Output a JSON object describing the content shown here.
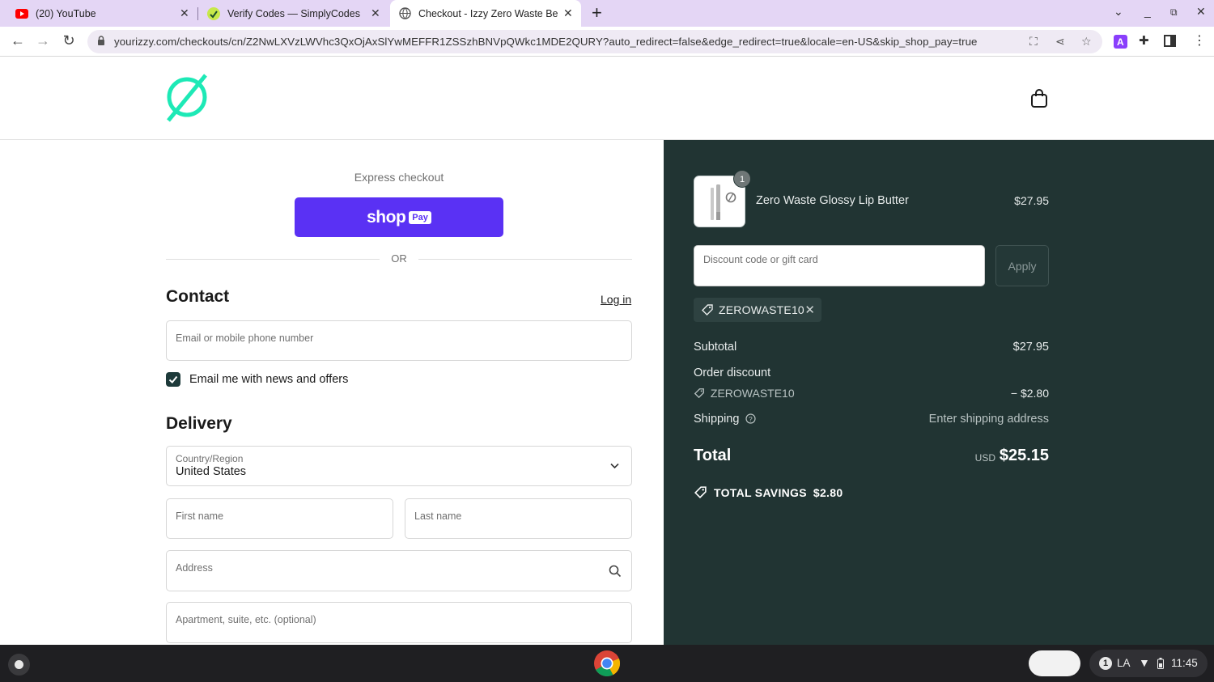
{
  "browser": {
    "tabs": [
      {
        "title": "(20) YouTube",
        "icon": "youtube-icon"
      },
      {
        "title": "Verify Codes — SimplyCodes",
        "icon": "simplycodes-icon"
      },
      {
        "title": "Checkout - Izzy Zero Waste Beau",
        "icon": "globe-icon",
        "active": true
      }
    ],
    "url": "yourizzy.com/checkouts/cn/Z2NwLXVzLWVhc3QxOjAxSlYwMEFFR1ZSSzhBNVpQWkc1MDE2QURY?auto_redirect=false&edge_redirect=true&locale=en-US&skip_shop_pay=true"
  },
  "checkout": {
    "express_label": "Express checkout",
    "shop_label": "shop",
    "pay_label": "Pay",
    "or_label": "OR",
    "contact_title": "Contact",
    "login_label": "Log in",
    "email_placeholder": "Email or mobile phone number",
    "news_label": "Email me with news and offers",
    "news_checked": true,
    "delivery_title": "Delivery",
    "country_label": "Country/Region",
    "country_value": "United States",
    "first_name_placeholder": "First name",
    "last_name_placeholder": "Last name",
    "address_placeholder": "Address",
    "apartment_placeholder": "Apartment, suite, etc. (optional)"
  },
  "summary": {
    "product": {
      "name": "Zero Waste Glossy Lip Butter",
      "price": "$27.95",
      "quantity": "1"
    },
    "discount_placeholder": "Discount code or gift card",
    "apply_label": "Apply",
    "applied_code": "ZEROWASTE10",
    "subtotal_label": "Subtotal",
    "subtotal_value": "$27.95",
    "order_discount_label": "Order discount",
    "discount_code": "ZEROWASTE10",
    "discount_value": "− $2.80",
    "shipping_label": "Shipping",
    "shipping_value": "Enter shipping address",
    "total_label": "Total",
    "total_currency": "USD",
    "total_value": "$25.15",
    "savings_label": "TOTAL SAVINGS",
    "savings_value": "$2.80"
  },
  "shelf": {
    "notification_count": "1",
    "input_method": "LA",
    "time": "11:45"
  },
  "colors": {
    "shop_pay": "#5a31f4",
    "summary_bg": "#213433",
    "accent_logo": "#1de9b6",
    "tab_bar": "#e4d6f5"
  }
}
